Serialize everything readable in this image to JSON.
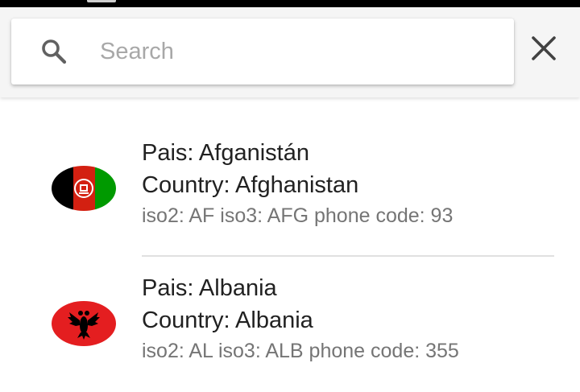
{
  "search": {
    "placeholder": "Search",
    "value": "",
    "icon": "search-icon",
    "close_icon": "close-icon"
  },
  "countries": [
    {
      "pais_label": "Pais: Afganistán",
      "country_label": "Country: Afghanistan",
      "codes_label": "iso2: AF iso3: AFG phone code: 93",
      "flag_icon": "afghanistan-flag-icon",
      "flag_colors": [
        "#000000",
        "#d32011",
        "#009a00"
      ]
    },
    {
      "pais_label": "Pais: Albania",
      "country_label": "Country: Albania",
      "codes_label": "iso2: AL iso3: ALB phone code: 355",
      "flag_icon": "albania-flag-icon",
      "flag_colors": [
        "#e41e20",
        "#000000"
      ]
    }
  ],
  "colors": {
    "toolbar_bg": "#f5f5f5",
    "primary_text": "#212121",
    "secondary_text": "#757575",
    "divider": "#e0e0e0"
  }
}
